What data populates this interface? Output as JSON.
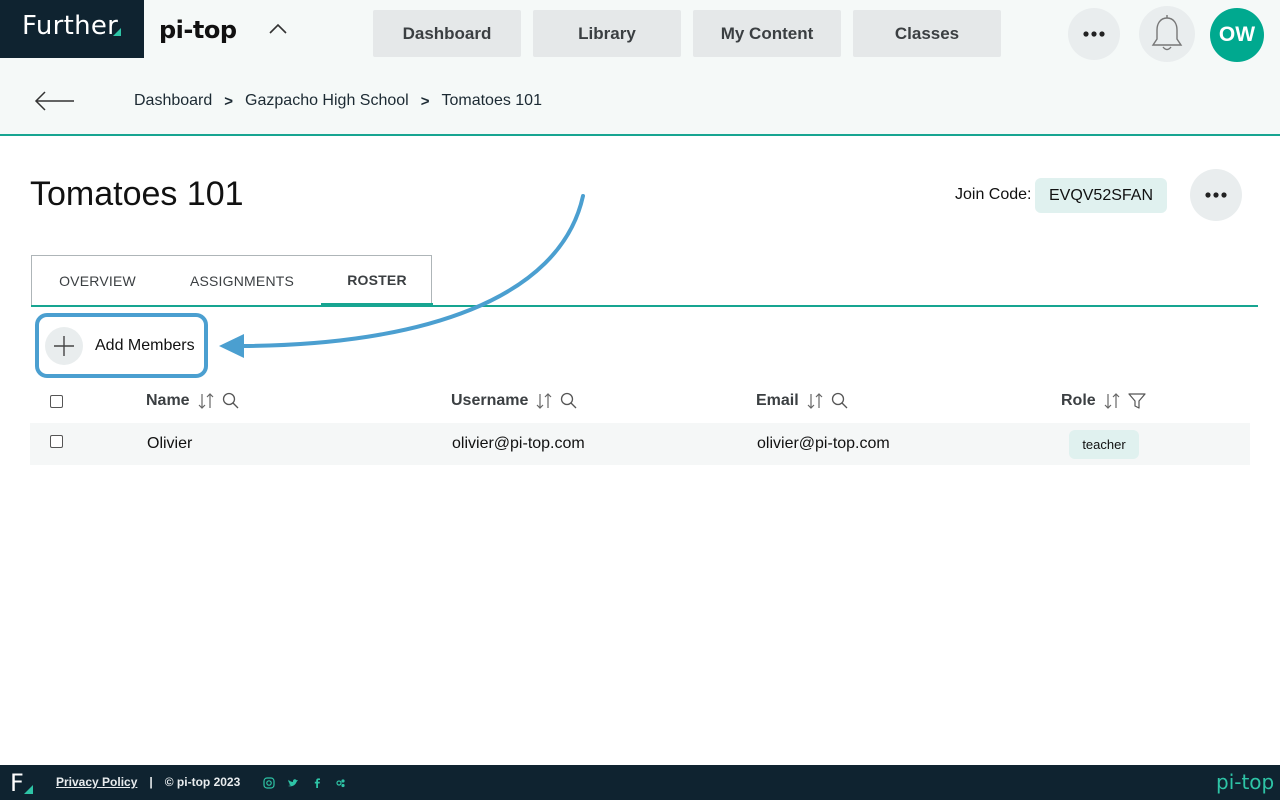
{
  "header": {
    "brand": "Further",
    "product": "pi-top",
    "nav": [
      "Dashboard",
      "Library",
      "My Content",
      "Classes"
    ],
    "avatar_initials": "OW"
  },
  "breadcrumb": {
    "items": [
      "Dashboard",
      "Gazpacho High School",
      "Tomatoes 101"
    ],
    "separator": ">"
  },
  "page": {
    "title": "Tomatoes 101",
    "join_code_label": "Join Code:",
    "join_code": "EVQV52SFAN"
  },
  "tabs": [
    {
      "label": "OVERVIEW",
      "active": false
    },
    {
      "label": "ASSIGNMENTS",
      "active": false
    },
    {
      "label": "ROSTER",
      "active": true
    }
  ],
  "roster": {
    "add_members_label": "Add Members",
    "columns": [
      "Name",
      "Username",
      "Email",
      "Role"
    ],
    "rows": [
      {
        "name": "Olivier",
        "username": "olivier@pi-top.com",
        "email": "olivier@pi-top.com",
        "role": "teacher"
      }
    ]
  },
  "footer": {
    "logo": "F",
    "privacy": "Privacy Policy",
    "divider": "|",
    "copyright": "© pi-top 2023",
    "brand": "pi-top",
    "social_icons": [
      "instagram-icon",
      "twitter-icon",
      "facebook-icon",
      "discord-icon"
    ]
  },
  "colors": {
    "brand_dark": "#0f2330",
    "accent_teal": "#17a591",
    "avatar": "#00a98f",
    "annotation_blue": "#4b9fd0"
  }
}
